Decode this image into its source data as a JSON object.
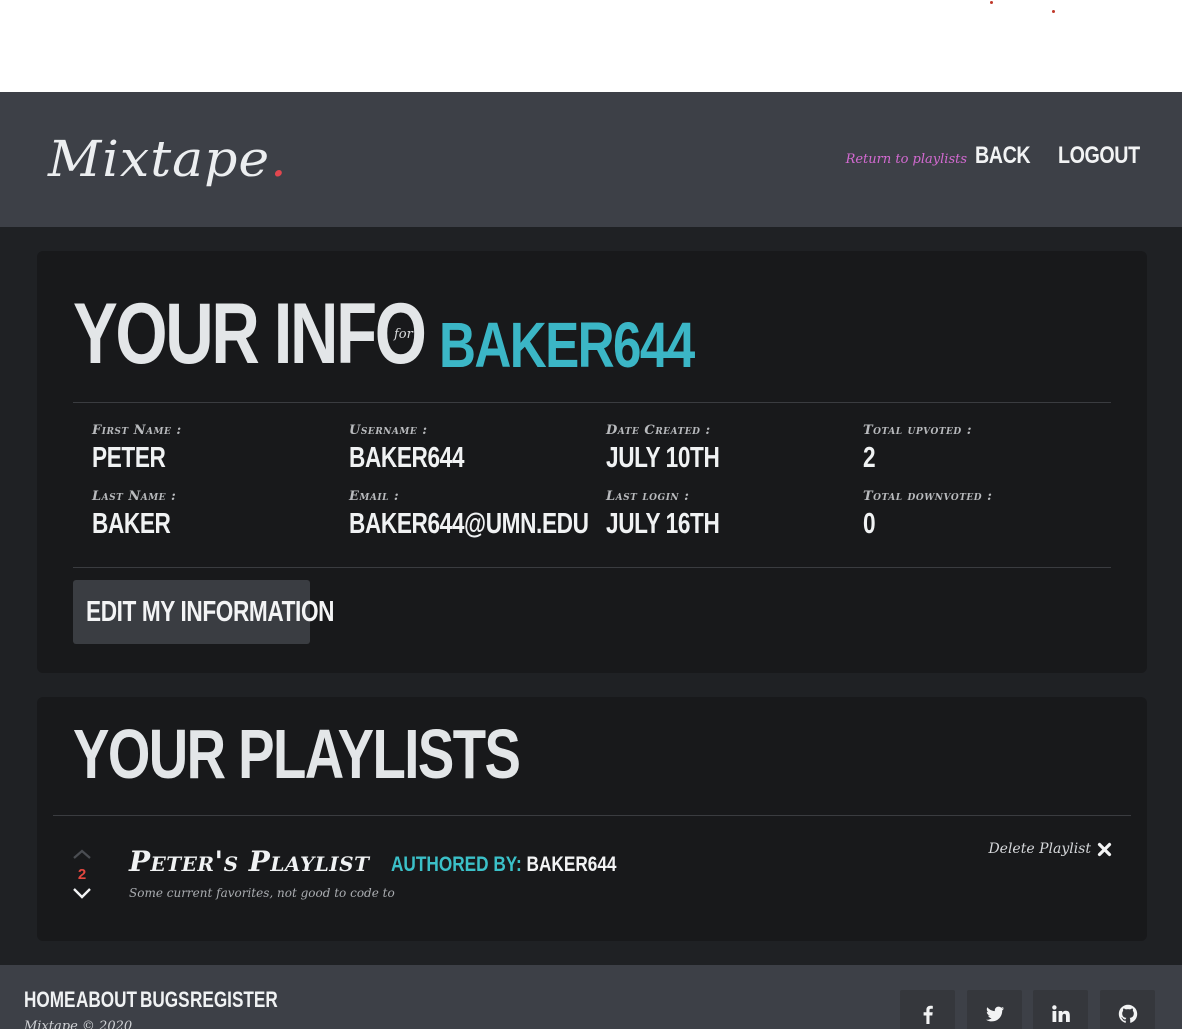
{
  "header": {
    "logo": "Mixtape",
    "logo_dot": ".",
    "hint": "Return to playlists",
    "nav": [
      "BACK",
      "LOGOUT"
    ]
  },
  "info": {
    "title": "YOUR INFO",
    "for": "for",
    "username": "BAKER644",
    "fields": [
      {
        "label": "First Name :",
        "value": "PETER"
      },
      {
        "label": "Username :",
        "value": "BAKER644"
      },
      {
        "label": "Date Created :",
        "value": "JULY 10TH"
      },
      {
        "label": "Total upvoted :",
        "value": "2"
      },
      {
        "label": "Last Name :",
        "value": "BAKER"
      },
      {
        "label": "Email :",
        "value": "BAKER644@UMN.EDU"
      },
      {
        "label": "Last login :",
        "value": "JULY 16TH"
      },
      {
        "label": "Total downvoted :",
        "value": "0"
      }
    ],
    "edit_label": "EDIT MY INFORMATION"
  },
  "playlists": {
    "title": "YOUR PLAYLISTS",
    "items": [
      {
        "name": "Peter's Playlist",
        "author_label": "AUTHORED BY:",
        "author": "BAKER644",
        "description": "Some current favorites, not good to code to",
        "votes": "2",
        "delete_label": "Delete Playlist"
      }
    ]
  },
  "footer": {
    "links": [
      "HOME",
      "ABOUT",
      "BUGS",
      "REGISTER"
    ],
    "copyright": "Mixtape © 2020",
    "social_icons": [
      "facebook-icon",
      "twitter-icon",
      "linkedin-icon",
      "github-icon"
    ]
  },
  "colors": {
    "accent": "#3bb6c6",
    "logo_dot": "#e2474f",
    "hint": "#d46ad2",
    "vote_count": "#e2473f"
  }
}
